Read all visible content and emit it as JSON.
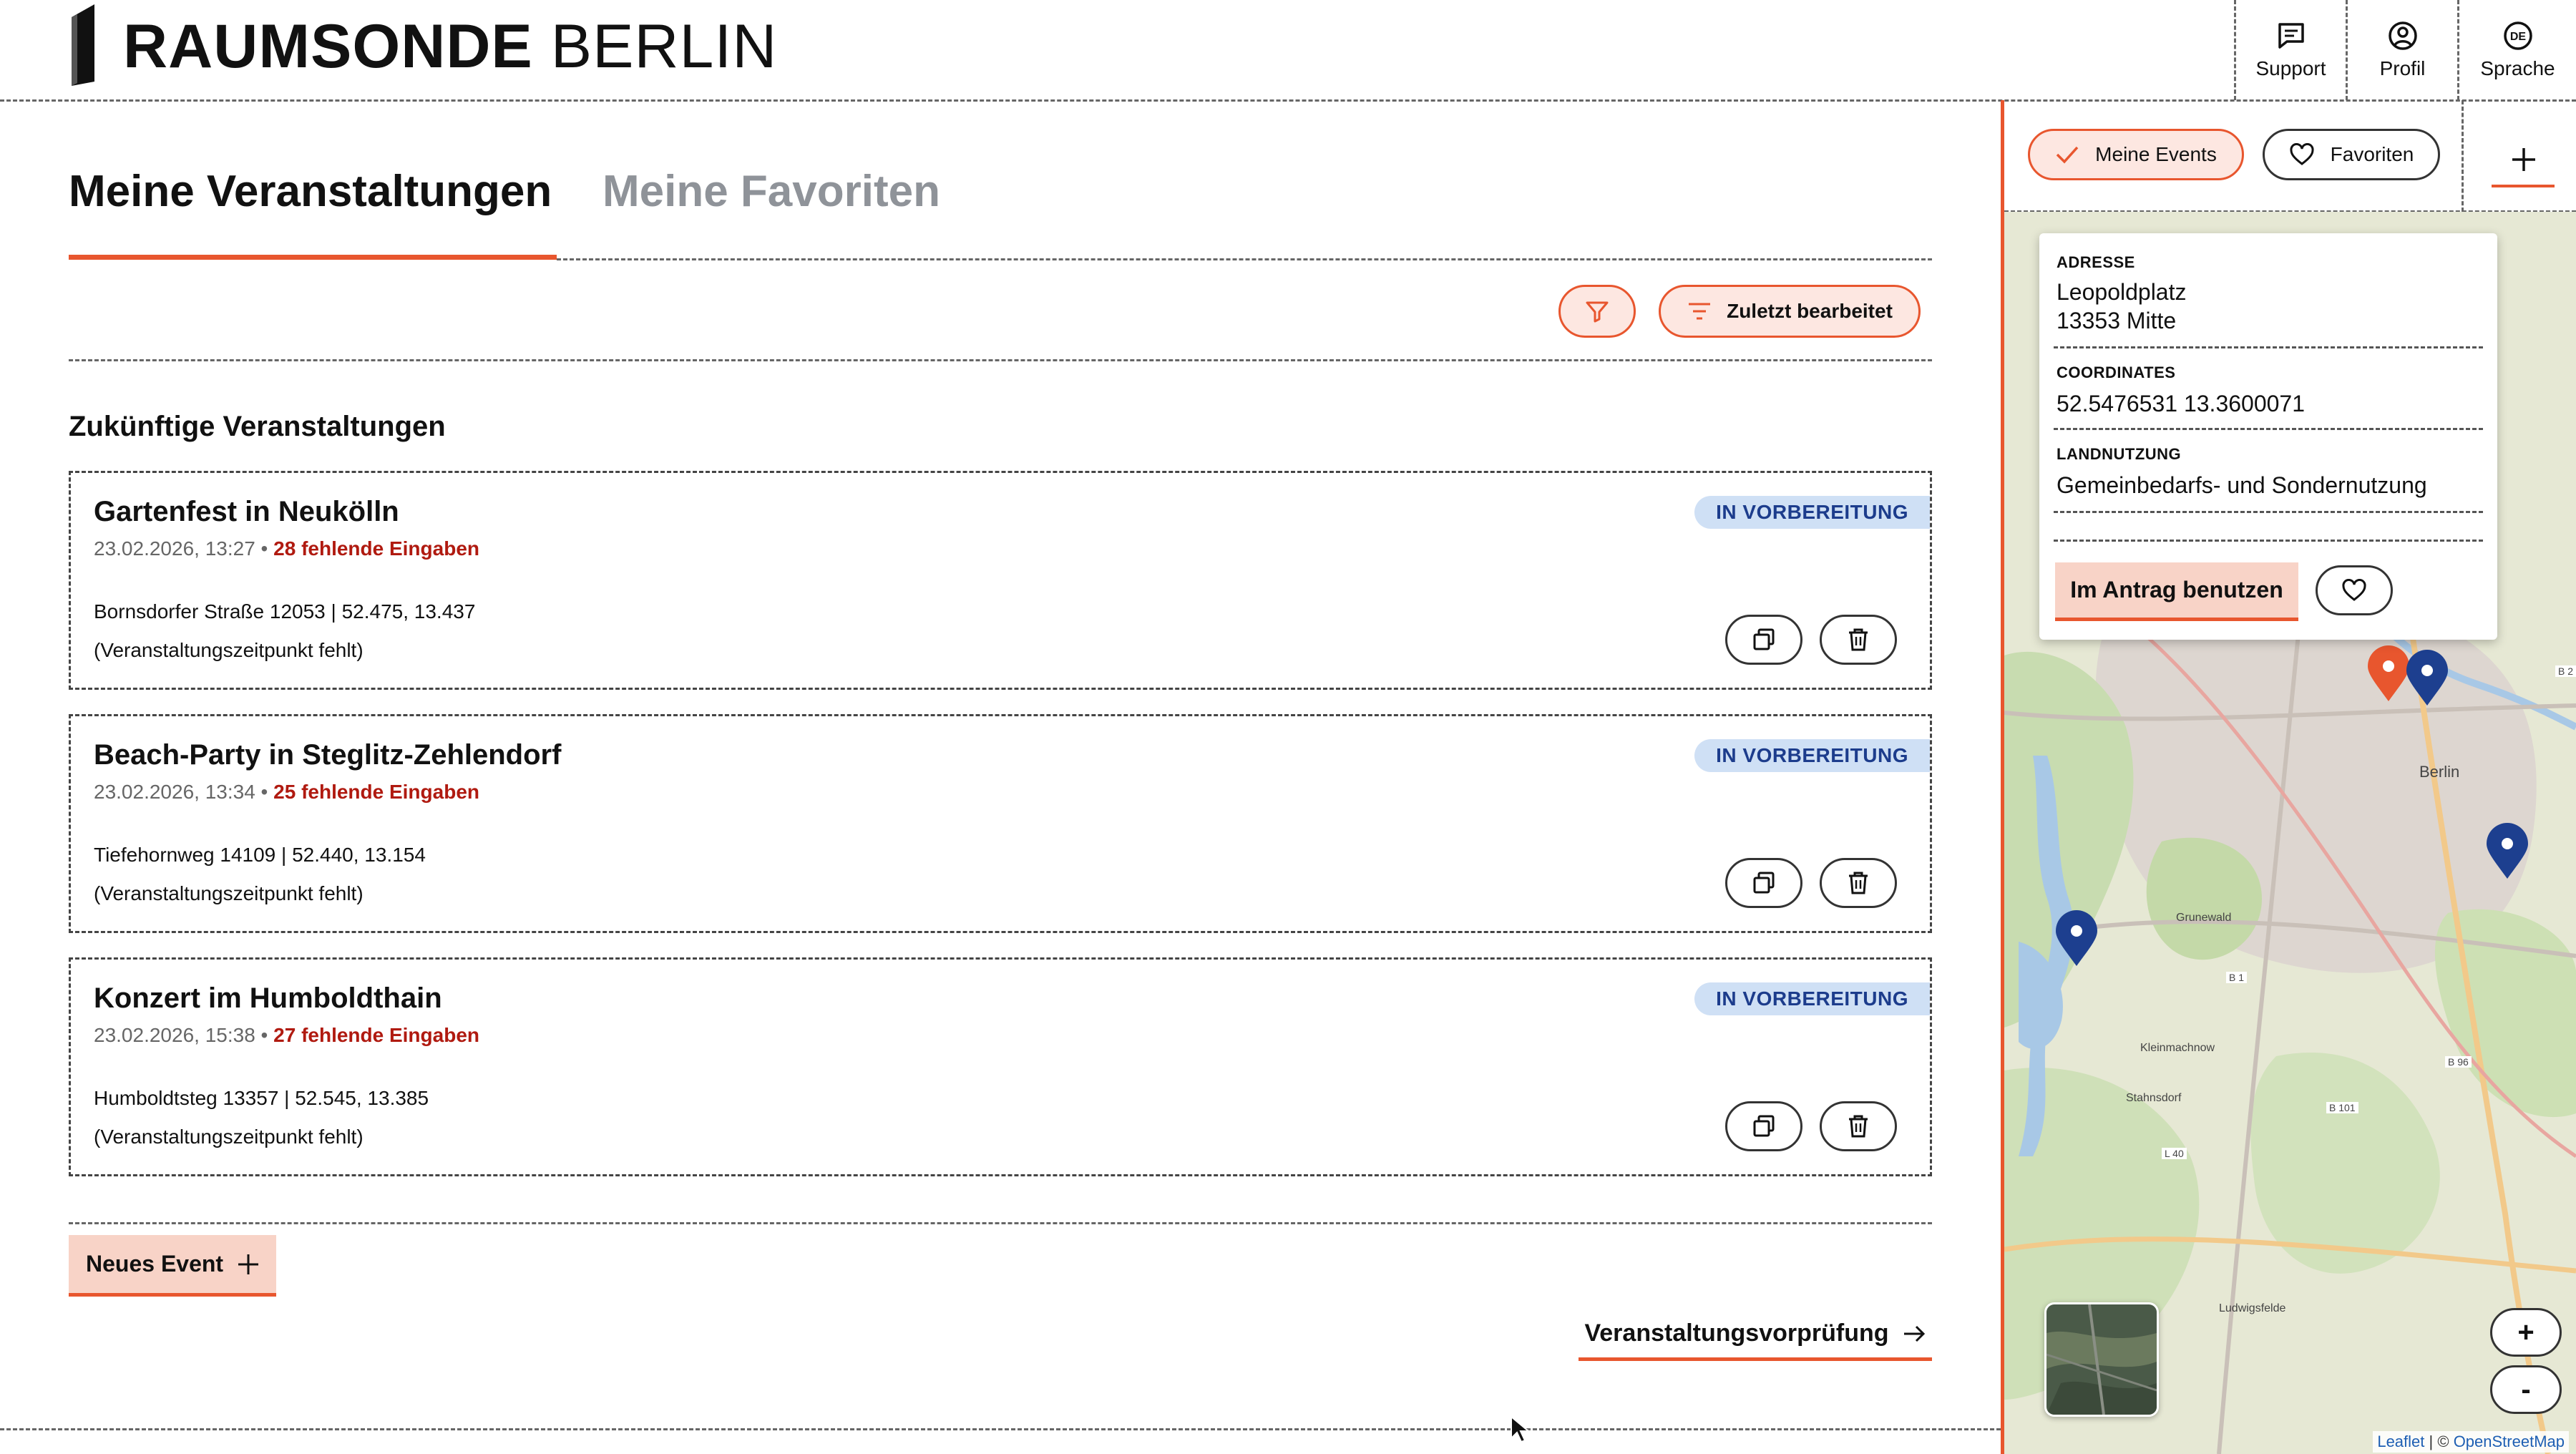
{
  "header": {
    "logo_bold": "RAUMSONDE",
    "logo_light": "BERLIN",
    "actions": [
      {
        "label": "Support",
        "icon": "chat-icon"
      },
      {
        "label": "Profil",
        "icon": "user-icon"
      },
      {
        "label": "Sprache",
        "icon": "language-de-icon",
        "icon_text": "DE"
      }
    ]
  },
  "tabs": [
    {
      "label": "Meine Veranstaltungen",
      "active": true
    },
    {
      "label": "Meine Favoriten",
      "active": false
    }
  ],
  "toolbar": {
    "sort_label": "Zuletzt bearbeitet"
  },
  "section_title": "Zukünftige Veranstaltungen",
  "events": [
    {
      "title": "Gartenfest in Neukölln",
      "date": "23.02.2026, 13:27",
      "separator": "•",
      "missing": "28 fehlende Eingaben",
      "status": "IN VORBEREITUNG",
      "address": "Bornsdorfer Straße 12053 | 52.475, 13.437",
      "note": "(Veranstaltungszeitpunkt fehlt)"
    },
    {
      "title": "Beach-Party in Steglitz-Zehlendorf",
      "date": "23.02.2026, 13:34",
      "separator": "•",
      "missing": "25 fehlende Eingaben",
      "status": "IN VORBEREITUNG",
      "address": "Tiefehornweg 14109 | 52.440, 13.154",
      "note": "(Veranstaltungszeitpunkt fehlt)"
    },
    {
      "title": "Konzert im Humboldthain",
      "date": "23.02.2026, 15:38",
      "separator": "•",
      "missing": "27 fehlende Eingaben",
      "status": "IN VORBEREITUNG",
      "address": "Humboldtsteg 13357 | 52.545, 13.385",
      "note": "(Veranstaltungszeitpunkt fehlt)"
    }
  ],
  "new_event_label": "Neues Event",
  "precheck_label": "Veranstaltungsvorprüfung",
  "map_panel": {
    "filter_my_events": "Meine Events",
    "filter_favorites": "Favoriten",
    "popup": {
      "address_label": "ADRESSE",
      "address_line1": "Leopoldplatz",
      "address_line2": "13353 Mitte",
      "coords_label": "COORDINATES",
      "coords_value": "52.5476531 13.3600071",
      "landuse_label": "LANDNUTZUNG",
      "landuse_value": "Gemeinbedarfs- und Sondernutzung",
      "use_button": "Im Antrag benutzen"
    },
    "zoom_in": "+",
    "zoom_out": "-",
    "attribution_leaflet": "Leaflet",
    "attribution_sep": "| ©",
    "attribution_osm": "OpenStreetMap",
    "place_labels": [
      "Berlin",
      "Grunewald",
      "Kleinmachnow",
      "Stahnsdorf",
      "Ludwigsfelde",
      "B 1",
      "B 96",
      "B 101",
      "L 40",
      "B 2"
    ],
    "colors": {
      "accent": "#e8562e",
      "marker_blue": "#1d3f8f",
      "marker_orange": "#e8562e"
    }
  }
}
